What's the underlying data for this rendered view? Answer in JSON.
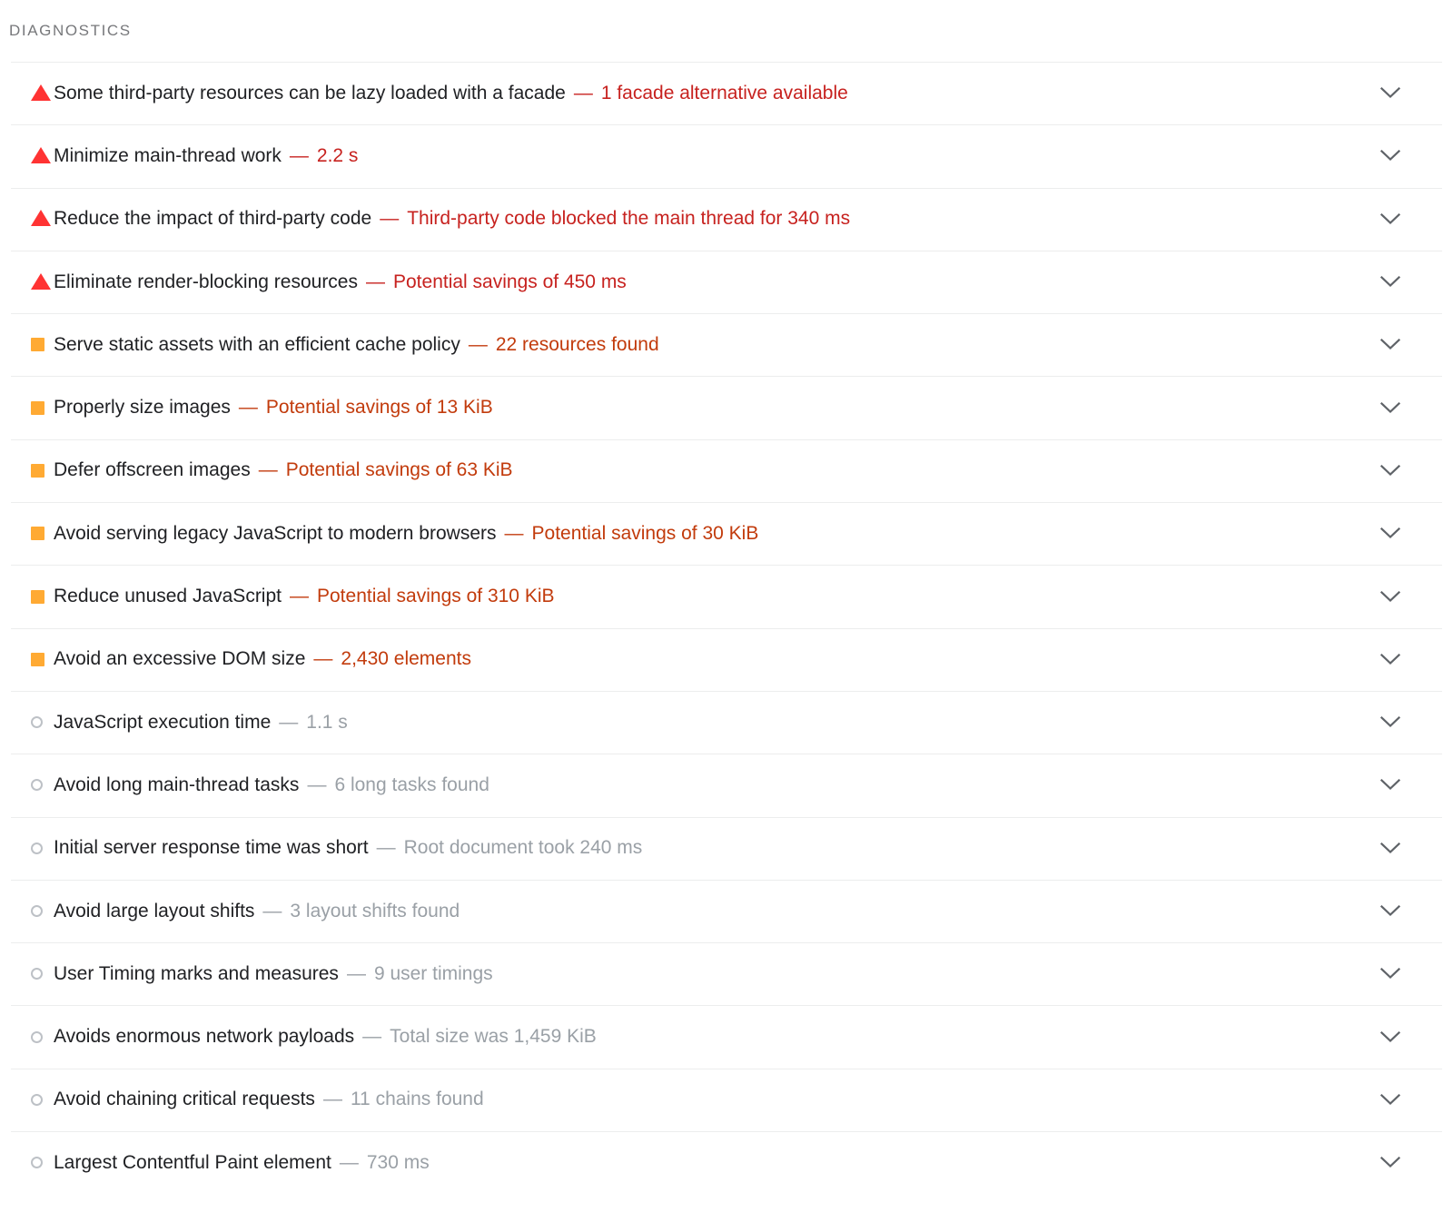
{
  "section": {
    "title": "DIAGNOSTICS"
  },
  "icons": {
    "fail": "red-triangle-icon",
    "average": "orange-square-icon",
    "pass": "gray-circle-icon",
    "expand": "chevron-down-icon"
  },
  "colors": {
    "fail": "#c7221f",
    "fail_icon": "#ff3333",
    "average": "#c23b0c",
    "average_icon": "#ffaa33",
    "pass": "#9aa0a6",
    "pass_icon": "#bdc1c6",
    "title": "#202124",
    "section_header": "#77787b",
    "divider": "#eceded"
  },
  "separator": "—",
  "audits": [
    {
      "severity": "fail",
      "icon": "red-triangle-icon",
      "title": "Some third-party resources can be lazy loaded with a facade",
      "value": "1 facade alternative available"
    },
    {
      "severity": "fail",
      "icon": "red-triangle-icon",
      "title": "Minimize main-thread work",
      "value": "2.2 s"
    },
    {
      "severity": "fail",
      "icon": "red-triangle-icon",
      "title": "Reduce the impact of third-party code",
      "value": "Third-party code blocked the main thread for 340 ms"
    },
    {
      "severity": "fail",
      "icon": "red-triangle-icon",
      "title": "Eliminate render-blocking resources",
      "value": "Potential savings of 450 ms"
    },
    {
      "severity": "average",
      "icon": "orange-square-icon",
      "title": "Serve static assets with an efficient cache policy",
      "value": "22 resources found"
    },
    {
      "severity": "average",
      "icon": "orange-square-icon",
      "title": "Properly size images",
      "value": "Potential savings of 13 KiB"
    },
    {
      "severity": "average",
      "icon": "orange-square-icon",
      "title": "Defer offscreen images",
      "value": "Potential savings of 63 KiB"
    },
    {
      "severity": "average",
      "icon": "orange-square-icon",
      "title": "Avoid serving legacy JavaScript to modern browsers",
      "value": "Potential savings of 30 KiB"
    },
    {
      "severity": "average",
      "icon": "orange-square-icon",
      "title": "Reduce unused JavaScript",
      "value": "Potential savings of 310 KiB"
    },
    {
      "severity": "average",
      "icon": "orange-square-icon",
      "title": "Avoid an excessive DOM size",
      "value": "2,430 elements"
    },
    {
      "severity": "pass",
      "icon": "gray-circle-icon",
      "title": "JavaScript execution time",
      "value": "1.1 s"
    },
    {
      "severity": "pass",
      "icon": "gray-circle-icon",
      "title": "Avoid long main-thread tasks",
      "value": "6 long tasks found"
    },
    {
      "severity": "pass",
      "icon": "gray-circle-icon",
      "title": "Initial server response time was short",
      "value": "Root document took 240 ms"
    },
    {
      "severity": "pass",
      "icon": "gray-circle-icon",
      "title": "Avoid large layout shifts",
      "value": "3 layout shifts found"
    },
    {
      "severity": "pass",
      "icon": "gray-circle-icon",
      "title": "User Timing marks and measures",
      "value": "9 user timings"
    },
    {
      "severity": "pass",
      "icon": "gray-circle-icon",
      "title": "Avoids enormous network payloads",
      "value": "Total size was 1,459 KiB"
    },
    {
      "severity": "pass",
      "icon": "gray-circle-icon",
      "title": "Avoid chaining critical requests",
      "value": "11 chains found"
    },
    {
      "severity": "pass",
      "icon": "gray-circle-icon",
      "title": "Largest Contentful Paint element",
      "value": "730 ms"
    }
  ]
}
